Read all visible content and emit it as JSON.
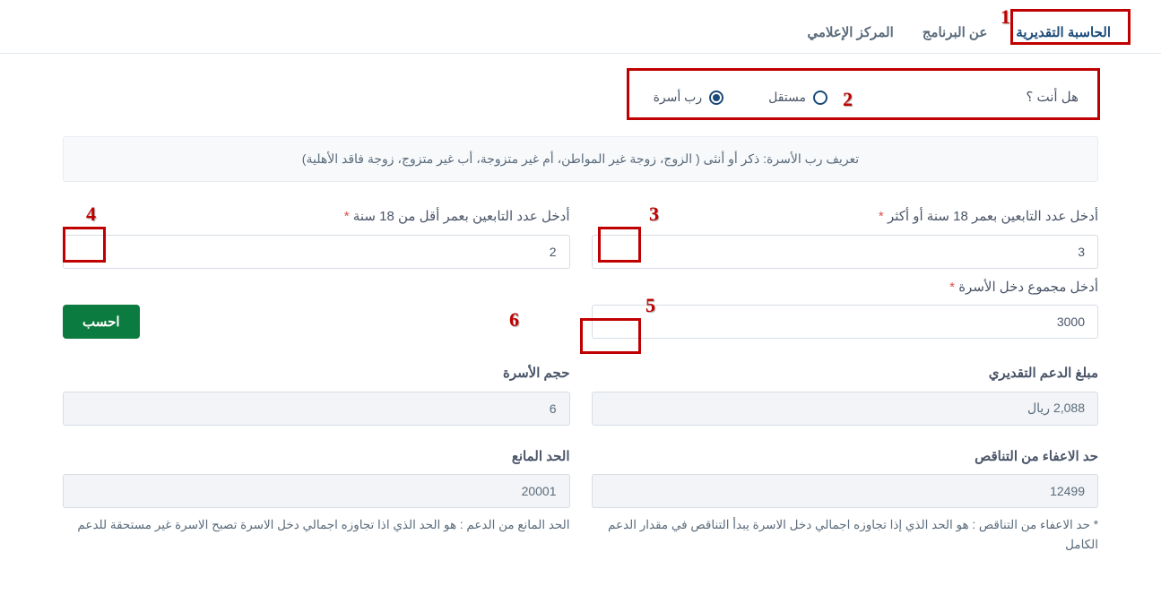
{
  "nav": {
    "tabs": [
      {
        "label": "الحاسبة التقديرية",
        "active": true
      },
      {
        "label": "عن البرنامج",
        "active": false
      },
      {
        "label": "المركز الإعلامي",
        "active": false
      }
    ]
  },
  "question": {
    "label": "هل أنت ؟",
    "options": [
      {
        "label": "مستقل",
        "selected": false
      },
      {
        "label": "رب أسرة",
        "selected": true
      }
    ]
  },
  "info_text": "تعريف رب الأسرة: ذكر أو أنثى ( الزوج، زوجة غير المواطن، أم غير متزوجة، أب غير متزوج، زوجة فاقد الأهلية)",
  "fields": {
    "adults": {
      "label": "أدخل عدد التابعين بعمر 18 سنة أو أكثر",
      "value": "3"
    },
    "minors": {
      "label": "أدخل عدد التابعين بعمر أقل من 18 سنة",
      "value": "2"
    },
    "income": {
      "label": "أدخل مجموع دخل الأسرة",
      "value": "3000"
    }
  },
  "calculate_label": "احسب",
  "results": {
    "estimated_support": {
      "label": "مبلغ الدعم التقديري",
      "value": "2,088 ريال"
    },
    "family_size": {
      "label": "حجم الأسرة",
      "value": "6"
    },
    "exemption_limit": {
      "label": "حد الاعفاء من التناقص",
      "value": "12499"
    },
    "blocking_limit": {
      "label": "الحد المانع",
      "value": "20001"
    }
  },
  "notes": {
    "exemption": "* حد الاعفاء من التناقص : هو الحد الذي إذا تجاوزه اجمالي دخل الاسرة يبدأ التناقص في مقدار الدعم الكامل",
    "blocking": "الحد المانع من الدعم : هو الحد الذي اذا تجاوزه اجمالي دخل الاسرة تصبح الاسرة غير مستحقة للدعم"
  },
  "required_mark": " *",
  "annotations": [
    "1",
    "2",
    "3",
    "4",
    "5",
    "6"
  ]
}
